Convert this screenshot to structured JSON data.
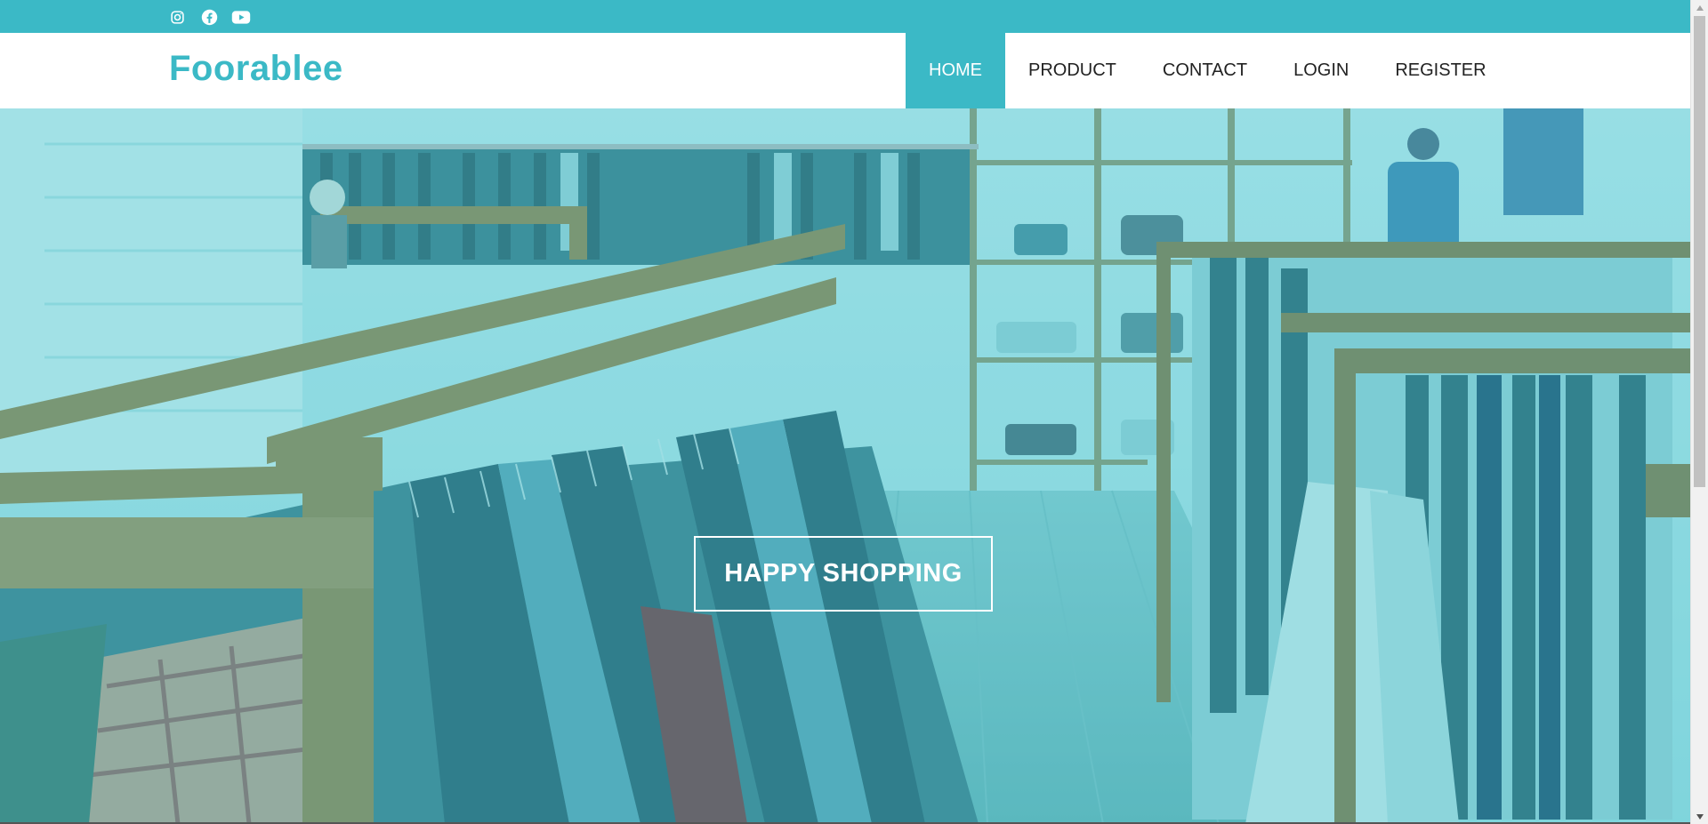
{
  "social": {
    "icons": [
      "instagram-icon",
      "facebook-icon",
      "youtube-icon"
    ]
  },
  "header": {
    "brand": "Foorablee",
    "nav": [
      {
        "label": "HOME",
        "active": true
      },
      {
        "label": "PRODUCT",
        "active": false
      },
      {
        "label": "CONTACT",
        "active": false
      },
      {
        "label": "LOGIN",
        "active": false
      },
      {
        "label": "REGISTER",
        "active": false
      }
    ]
  },
  "hero": {
    "cta_label": "HAPPY SHOPPING",
    "image_description": "clothing store interior with wooden racks of shirts, teal tint"
  },
  "colors": {
    "accent": "#3bb9c6",
    "nav_text": "#222222",
    "white": "#ffffff"
  }
}
